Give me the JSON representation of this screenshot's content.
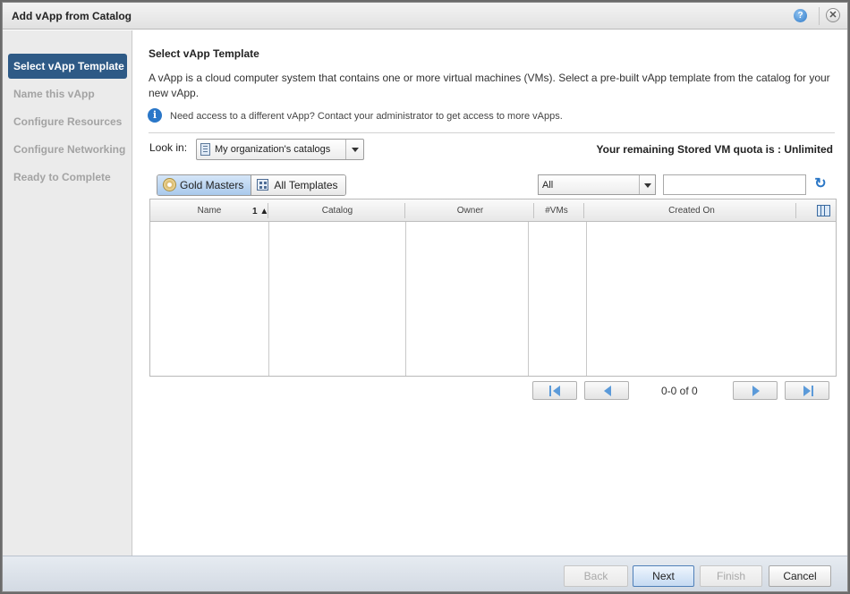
{
  "dialog": {
    "title": "Add vApp from Catalog"
  },
  "titlebar": {
    "help_icon": "help-icon",
    "help_glyph": "?",
    "close_icon": "close-icon",
    "close_glyph": "✕"
  },
  "steps": [
    {
      "label": "Select vApp Template",
      "active": true
    },
    {
      "label": "Name this vApp",
      "active": false
    },
    {
      "label": "Configure Resources",
      "active": false
    },
    {
      "label": "Configure Networking",
      "active": false
    },
    {
      "label": "Ready to Complete",
      "active": false
    }
  ],
  "main": {
    "heading": "Select vApp Template",
    "description": "A vApp is a cloud computer system that contains one or more virtual machines (VMs). Select a pre-built vApp template from the catalog for your new vApp.",
    "info_icon_glyph": "i",
    "info_text": "Need access to a different vApp? Contact your administrator to get access to more vApps.",
    "look_in_label": "Look in:",
    "look_in_value": "My organization's catalogs",
    "quota_text": "Your remaining Stored VM quota is : Unlimited"
  },
  "toolbar": {
    "gold_masters_label": "Gold Masters",
    "all_templates_label": "All Templates",
    "filter_value": "All",
    "search_value": "",
    "refresh_glyph": "↻"
  },
  "grid": {
    "columns": [
      "Name",
      "Catalog",
      "Owner",
      "#VMs",
      "Created On"
    ],
    "sort_indicator": "1 ▲",
    "rows": []
  },
  "pager": {
    "text": "0-0 of 0"
  },
  "footer": {
    "back": "Back",
    "next": "Next",
    "finish": "Finish",
    "cancel": "Cancel"
  },
  "colors": {
    "active_step": "#2e5a86",
    "accent": "#2a77c8"
  }
}
